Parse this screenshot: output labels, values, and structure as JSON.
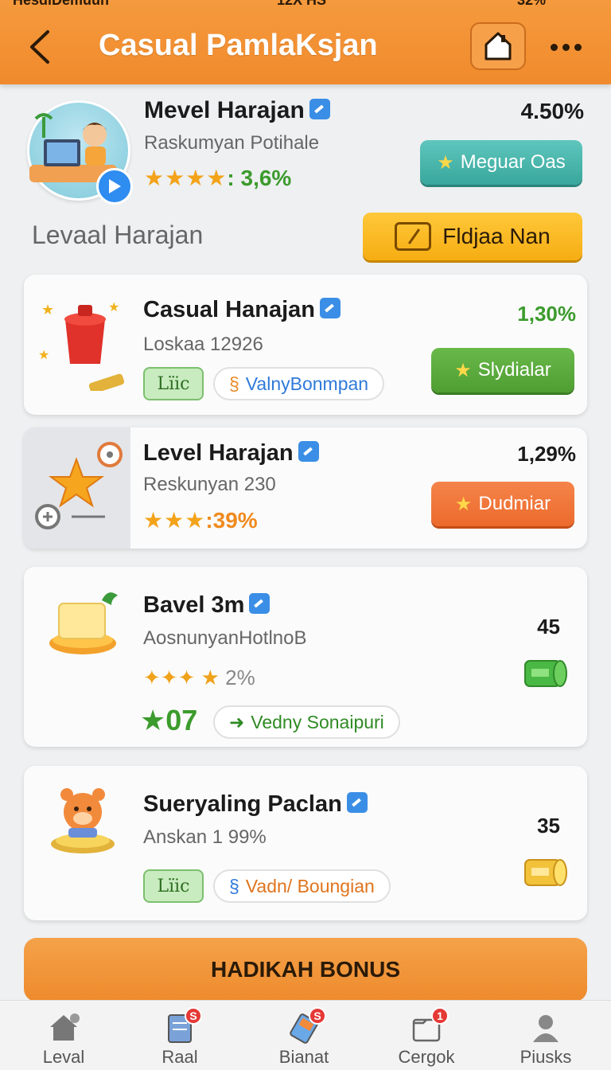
{
  "status_bar": {
    "left": "HesdiDemuun",
    "center": "12X HS",
    "right": "32%"
  },
  "header": {
    "title": "Casual PamlaKsjan"
  },
  "profile": {
    "name": "Mevel Harajan",
    "subtitle": "Raskumyan Potihale",
    "stars": "★★★★",
    "rating": ": 3,6%",
    "percent": "4.50%",
    "action": "Meguar Oas"
  },
  "section": {
    "label": "Levaal Harajan",
    "action": "Fldjaa Nan"
  },
  "cards": [
    {
      "name": "Casual Hanajan",
      "subtitle": "Loskaa 12926",
      "percent": "1,30%",
      "tag": "Lïic",
      "pill": "ValnyBonmpan",
      "action": "Slydialar"
    },
    {
      "name": "Level Harajan",
      "subtitle": "Reskunyan 230",
      "percent": "1,29%",
      "stars": "★★★",
      "rating": ":39%",
      "action": "Dudmiar"
    },
    {
      "name": "Bavel 3m",
      "subtitle": "AosnunyanHotlnoB",
      "percent": "45",
      "stars": "✦✦✦ ★",
      "rating": "2%",
      "score": "07",
      "pill": "Vedny Sonaipuri"
    },
    {
      "name": "Sueryaling Paclan",
      "subtitle": "Anskan 1 99%",
      "percent": "35",
      "tag": "Lïic",
      "pill": "Vadn/ Boungian"
    }
  ],
  "bonus_button": "HADIKAH BONUS",
  "nav": [
    {
      "label": "Leval",
      "badge": ""
    },
    {
      "label": "Raal",
      "badge": "S"
    },
    {
      "label": "Bianat",
      "badge": "S"
    },
    {
      "label": "Cergok",
      "badge": "1"
    },
    {
      "label": "Piusks",
      "badge": ""
    }
  ],
  "colors": {
    "header": "#f08a2c",
    "teal_button": "#38a79c",
    "yellow_button": "#f6ad12",
    "green_button": "#4f9e32",
    "orange_button": "#ec6a2c",
    "accent_green_text": "#3c9b2d"
  }
}
